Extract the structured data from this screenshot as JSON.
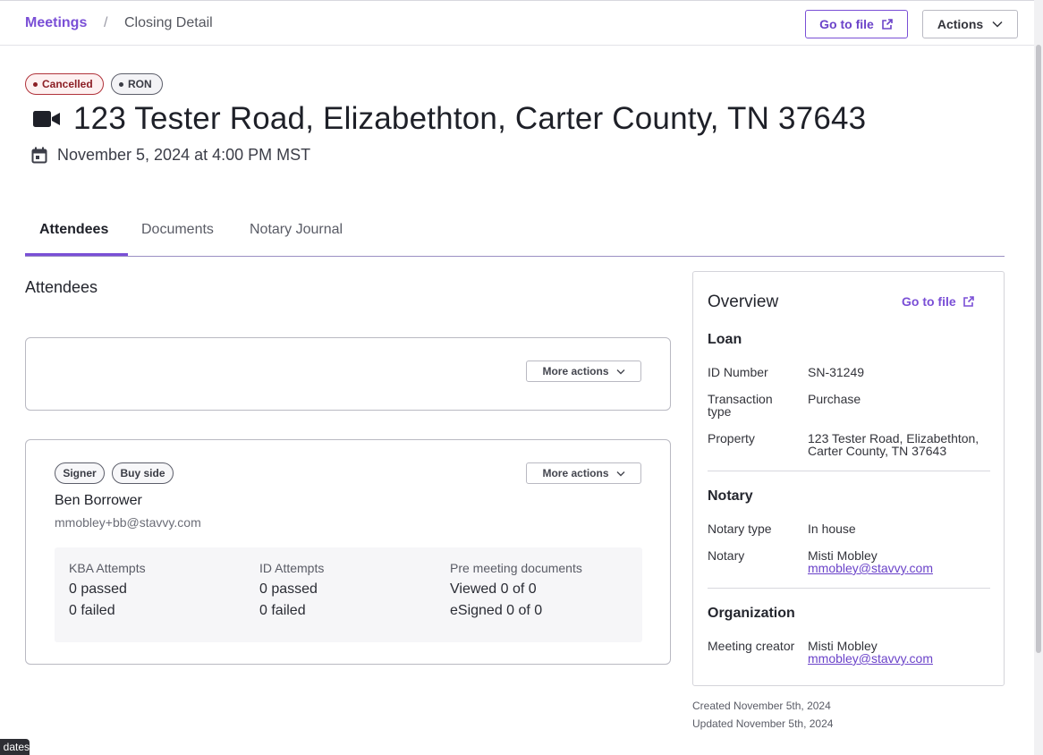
{
  "breadcrumb": {
    "root": "Meetings",
    "separator": "/",
    "current": "Closing Detail"
  },
  "header": {
    "go_to_file": "Go to file",
    "actions": "Actions"
  },
  "meeting": {
    "status_badge": "Cancelled",
    "type_badge": "RON",
    "title": "123 Tester Road, Elizabethton, Carter County, TN 37643",
    "datetime": "November 5, 2024 at 4:00 PM MST"
  },
  "tabs": [
    {
      "label": "Attendees",
      "active": true
    },
    {
      "label": "Documents",
      "active": false
    },
    {
      "label": "Notary Journal",
      "active": false
    }
  ],
  "attendees": {
    "section_title": "Attendees",
    "more_actions": "More actions",
    "signer": {
      "tags": [
        "Signer",
        "Buy side"
      ],
      "name": "Ben Borrower",
      "email": "mmobley+bb@stavvy.com",
      "stats": [
        {
          "label": "KBA Attempts",
          "lines": [
            "0 passed",
            "0 failed"
          ]
        },
        {
          "label": "ID Attempts",
          "lines": [
            "0 passed",
            "0 failed"
          ]
        },
        {
          "label": "Pre meeting documents",
          "lines": [
            "Viewed 0 of 0",
            "eSigned 0 of 0"
          ]
        }
      ]
    }
  },
  "overview": {
    "title": "Overview",
    "go_to_file": "Go to file",
    "loan": {
      "heading": "Loan",
      "id_label": "ID Number",
      "id_value": "SN-31249",
      "transaction_label_1": "Transaction",
      "transaction_label_2": "type",
      "transaction_value": "Purchase",
      "property_label": "Property",
      "property_value_1": "123 Tester Road, Elizabethton,",
      "property_value_2": "Carter County, TN 37643"
    },
    "notary": {
      "heading": "Notary",
      "type_label": "Notary type",
      "type_value": "In house",
      "notary_label": "Notary",
      "notary_name": "Misti Mobley",
      "notary_email": "mmobley@stavvy.com"
    },
    "organization": {
      "heading": "Organization",
      "creator_label": "Meeting creator",
      "creator_name": "Misti Mobley",
      "creator_email": "mmobley@stavvy.com"
    }
  },
  "meta": {
    "created": "Created November 5th, 2024",
    "updated": "Updated November 5th, 2024"
  },
  "toast": "dates",
  "colors": {
    "accent": "#7a4fd6",
    "cancelled": "#b0323a"
  }
}
